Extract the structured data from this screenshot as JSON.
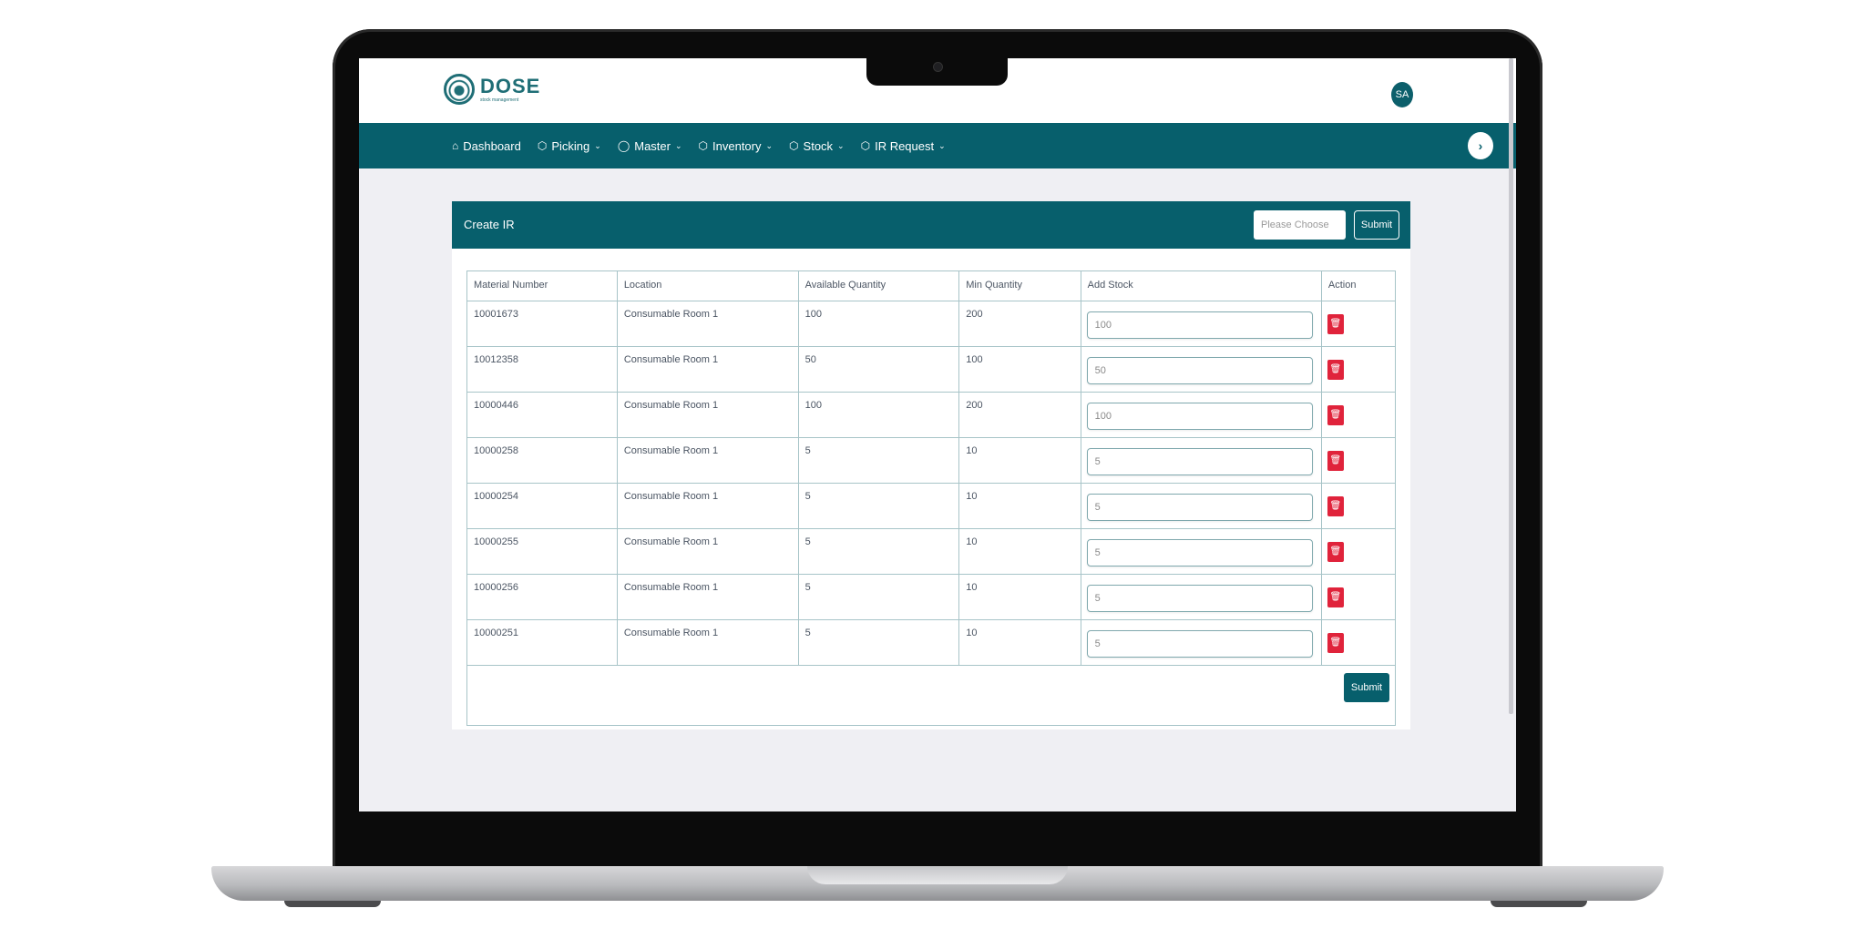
{
  "app": {
    "logo_title": "DOSE",
    "logo_subtitle": "stock management",
    "avatar_initials": "SA"
  },
  "nav": {
    "items": [
      {
        "label": "Dashboard",
        "icon": "home-icon",
        "has_dropdown": false
      },
      {
        "label": "Picking",
        "icon": "box-icon",
        "has_dropdown": true
      },
      {
        "label": "Master",
        "icon": "circle-icon",
        "has_dropdown": true
      },
      {
        "label": "Inventory",
        "icon": "box-icon",
        "has_dropdown": true
      },
      {
        "label": "Stock",
        "icon": "box-icon",
        "has_dropdown": true
      },
      {
        "label": "IR Request",
        "icon": "box-icon",
        "has_dropdown": true
      }
    ],
    "toggle_symbol": "›"
  },
  "card": {
    "title": "Create IR",
    "select_placeholder": "Please Choose",
    "header_submit": "Submit",
    "footer_submit": "Submit"
  },
  "table": {
    "headers": [
      "Material Number",
      "Location",
      "Available Quantity",
      "Min Quantity",
      "Add Stock",
      "Action"
    ],
    "rows": [
      {
        "material": "10001673",
        "location": "Consumable Room 1",
        "available": "100",
        "min": "200",
        "add_stock": "100"
      },
      {
        "material": "10012358",
        "location": "Consumable Room 1",
        "available": "50",
        "min": "100",
        "add_stock": "50"
      },
      {
        "material": "10000446",
        "location": "Consumable Room 1",
        "available": "100",
        "min": "200",
        "add_stock": "100"
      },
      {
        "material": "10000258",
        "location": "Consumable Room 1",
        "available": "5",
        "min": "10",
        "add_stock": "5"
      },
      {
        "material": "10000254",
        "location": "Consumable Room 1",
        "available": "5",
        "min": "10",
        "add_stock": "5"
      },
      {
        "material": "10000255",
        "location": "Consumable Room 1",
        "available": "5",
        "min": "10",
        "add_stock": "5"
      },
      {
        "material": "10000256",
        "location": "Consumable Room 1",
        "available": "5",
        "min": "10",
        "add_stock": "5"
      },
      {
        "material": "10000251",
        "location": "Consumable Room 1",
        "available": "5",
        "min": "10",
        "add_stock": "5"
      }
    ]
  },
  "colors": {
    "primary": "#075f6c",
    "danger": "#e0233b",
    "background": "#efeff3"
  }
}
